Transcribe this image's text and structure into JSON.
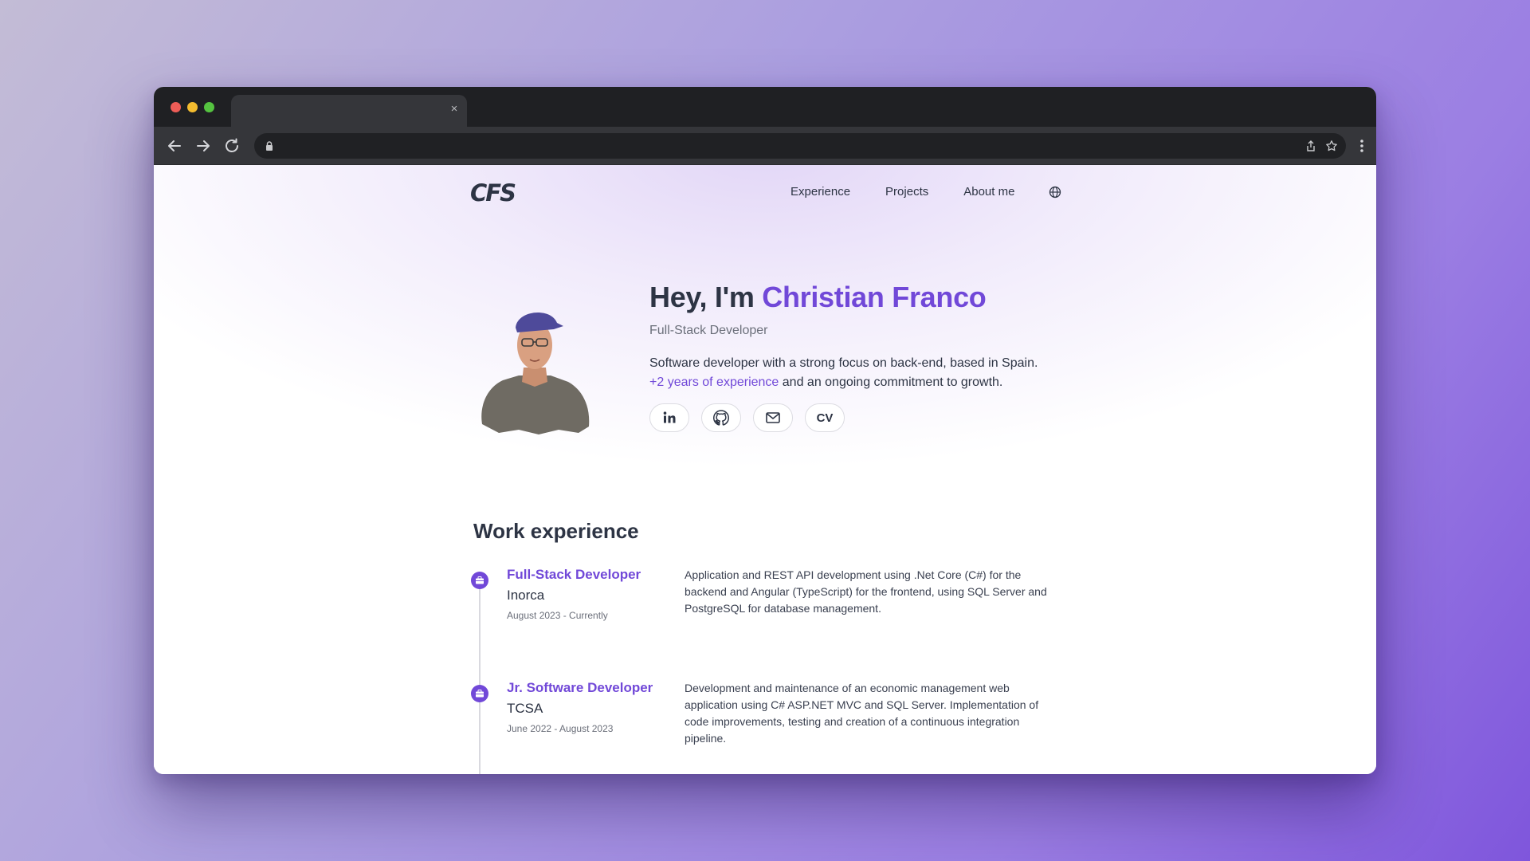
{
  "browser": {
    "tab_close": "×",
    "back_icon": "arrow-left-icon",
    "forward_icon": "arrow-right-icon",
    "reload_icon": "reload-icon",
    "address": ""
  },
  "nav": {
    "logo": "CFS",
    "links": [
      "Experience",
      "Projects",
      "About me"
    ],
    "language_icon": "globe-icon"
  },
  "hero": {
    "greeting": "Hey, I'm ",
    "name": "Christian Franco",
    "subtitle": "Full-Stack Developer",
    "desc_before": "Software developer with a strong focus on back-end, based in Spain. ",
    "desc_accent": "+2 years of experience",
    "desc_after": " and an ongoing commitment to growth.",
    "socials": [
      "linkedin-icon",
      "github-icon",
      "mail-icon"
    ],
    "cv_label": "CV"
  },
  "experience": {
    "title": "Work experience",
    "jobs": [
      {
        "role": "Full-Stack Developer",
        "company": "Inorca",
        "date": "August 2023 - Currently",
        "description": "Application and REST API development using .Net Core (C#) for the backend and Angular (TypeScript) for the frontend, using SQL Server and PostgreSQL for database management."
      },
      {
        "role": "Jr. Software Developer",
        "company": "TCSA",
        "date": "June 2022 - August 2023",
        "description": "Development and maintenance of an economic management web application using C# ASP.NET MVC and SQL Server. Implementation of code improvements, testing and creation of a continuous integration pipeline."
      }
    ]
  },
  "colors": {
    "accent": "#7148d8",
    "text": "#2d3444",
    "chrome": "#1f2023"
  }
}
